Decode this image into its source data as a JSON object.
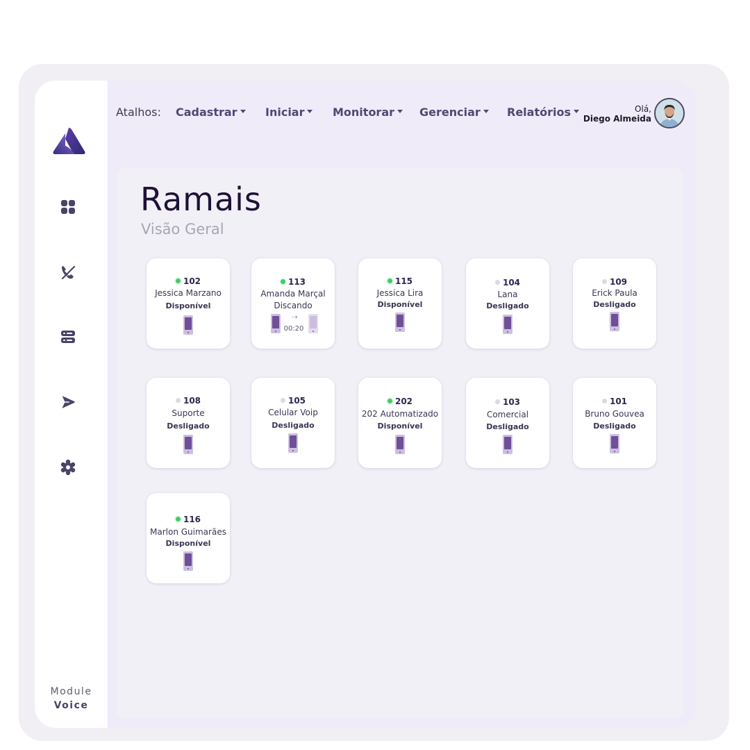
{
  "sidebar": {
    "logo_icon": "app-logo",
    "nav": [
      {
        "icon": "dashboard-grid-icon"
      },
      {
        "icon": "phone-off-icon"
      },
      {
        "icon": "server-list-icon"
      },
      {
        "icon": "send-icon"
      },
      {
        "icon": "gear-icon"
      }
    ],
    "module_label": "Module",
    "module_name": "Voice"
  },
  "topbar": {
    "shortcuts_label": "Atalhos:",
    "menus": [
      "Cadastrar",
      "Iniciar",
      "Monitorar",
      "Gerenciar",
      "Relatórios"
    ],
    "greeting": "Olá,",
    "user_name": "Diego Almeida"
  },
  "page": {
    "title": "Ramais",
    "subtitle": "Visão Geral"
  },
  "extensions": [
    {
      "number": "102",
      "name": "Jessica Marzano",
      "status": "Disponível",
      "online": true
    },
    {
      "number": "113",
      "name": "Amanda Marçal",
      "status": "Discando",
      "online": true,
      "timer": "00:20"
    },
    {
      "number": "115",
      "name": "Jessica Lira",
      "status": "Disponível",
      "online": true
    },
    {
      "number": "104",
      "name": "Lana",
      "status": "Desligado",
      "online": false
    },
    {
      "number": "109",
      "name": "Erick Paula",
      "status": "Desligado",
      "online": false
    },
    {
      "number": "108",
      "name": "Suporte",
      "status": "Desligado",
      "online": false
    },
    {
      "number": "105",
      "name": "Celular Voip",
      "status": "Desligado",
      "online": false
    },
    {
      "number": "202",
      "name": "202 Automatizado",
      "status": "Disponível",
      "online": true
    },
    {
      "number": "103",
      "name": "Comercial",
      "status": "Desligado",
      "online": false
    },
    {
      "number": "101",
      "name": "Bruno Gouvea",
      "status": "Desligado",
      "online": false
    },
    {
      "number": "116",
      "name": "Marlon Guimarães",
      "status": "Disponível",
      "online": true
    }
  ],
  "colors": {
    "accent": "#4f4872",
    "online": "#3ecf66",
    "offline": "#dcd9e2",
    "title": "#1f1235"
  }
}
